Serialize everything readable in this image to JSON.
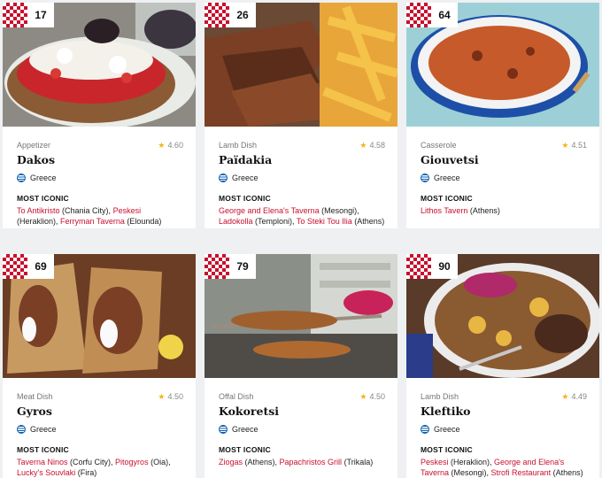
{
  "cards": [
    {
      "rank": "17",
      "category": "Appetizer",
      "rating": "4.60",
      "name": "Dakos",
      "country": "Greece",
      "most_iconic_label": "MOST ICONIC",
      "places": [
        [
          "To Antikristo",
          " (Chania City), "
        ],
        [
          "Peskesi",
          " (Heraklion), "
        ],
        [
          "Ferryman Taverna",
          " (Elounda)"
        ]
      ]
    },
    {
      "rank": "26",
      "category": "Lamb Dish",
      "rating": "4.58",
      "name": "Païdakia",
      "country": "Greece",
      "most_iconic_label": "MOST ICONIC",
      "places": [
        [
          "George and Elena's Taverna",
          " (Mesongi), "
        ],
        [
          "Ladokolla",
          " (Temploni), "
        ],
        [
          "To Steki Tou Ilia",
          " (Athens)"
        ]
      ]
    },
    {
      "rank": "64",
      "category": "Casserole",
      "rating": "4.51",
      "name": "Giouvetsi",
      "country": "Greece",
      "most_iconic_label": "MOST ICONIC",
      "places": [
        [
          "Lithos Tavern",
          " (Athens)"
        ]
      ]
    },
    {
      "rank": "69",
      "category": "Meat Dish",
      "rating": "4.50",
      "name": "Gyros",
      "country": "Greece",
      "most_iconic_label": "MOST ICONIC",
      "places": [
        [
          "Taverna Ninos",
          " (Corfu City), "
        ],
        [
          "Pitogyros",
          " (Oia), "
        ],
        [
          "Lucky's Souvlaki",
          " (Fira)"
        ]
      ]
    },
    {
      "rank": "79",
      "category": "Offal Dish",
      "rating": "4.50",
      "name": "Kokoretsi",
      "country": "Greece",
      "most_iconic_label": "MOST ICONIC",
      "places": [
        [
          "Ziogas",
          " (Athens), "
        ],
        [
          "Papachristos Grill",
          " (Trikala)"
        ]
      ]
    },
    {
      "rank": "90",
      "category": "Lamb Dish",
      "rating": "4.49",
      "name": "Kleftiko",
      "country": "Greece",
      "most_iconic_label": "MOST ICONIC",
      "places": [
        [
          "Peskesi",
          " (Heraklion), "
        ],
        [
          "George and Elena's Taverna",
          " (Mesongi), "
        ],
        [
          "Strofi Restaurant",
          " (Athens)"
        ]
      ]
    }
  ],
  "colors": {
    "accent": "#c8102e",
    "star": "#f2b51b",
    "background": "#eef0f2"
  }
}
